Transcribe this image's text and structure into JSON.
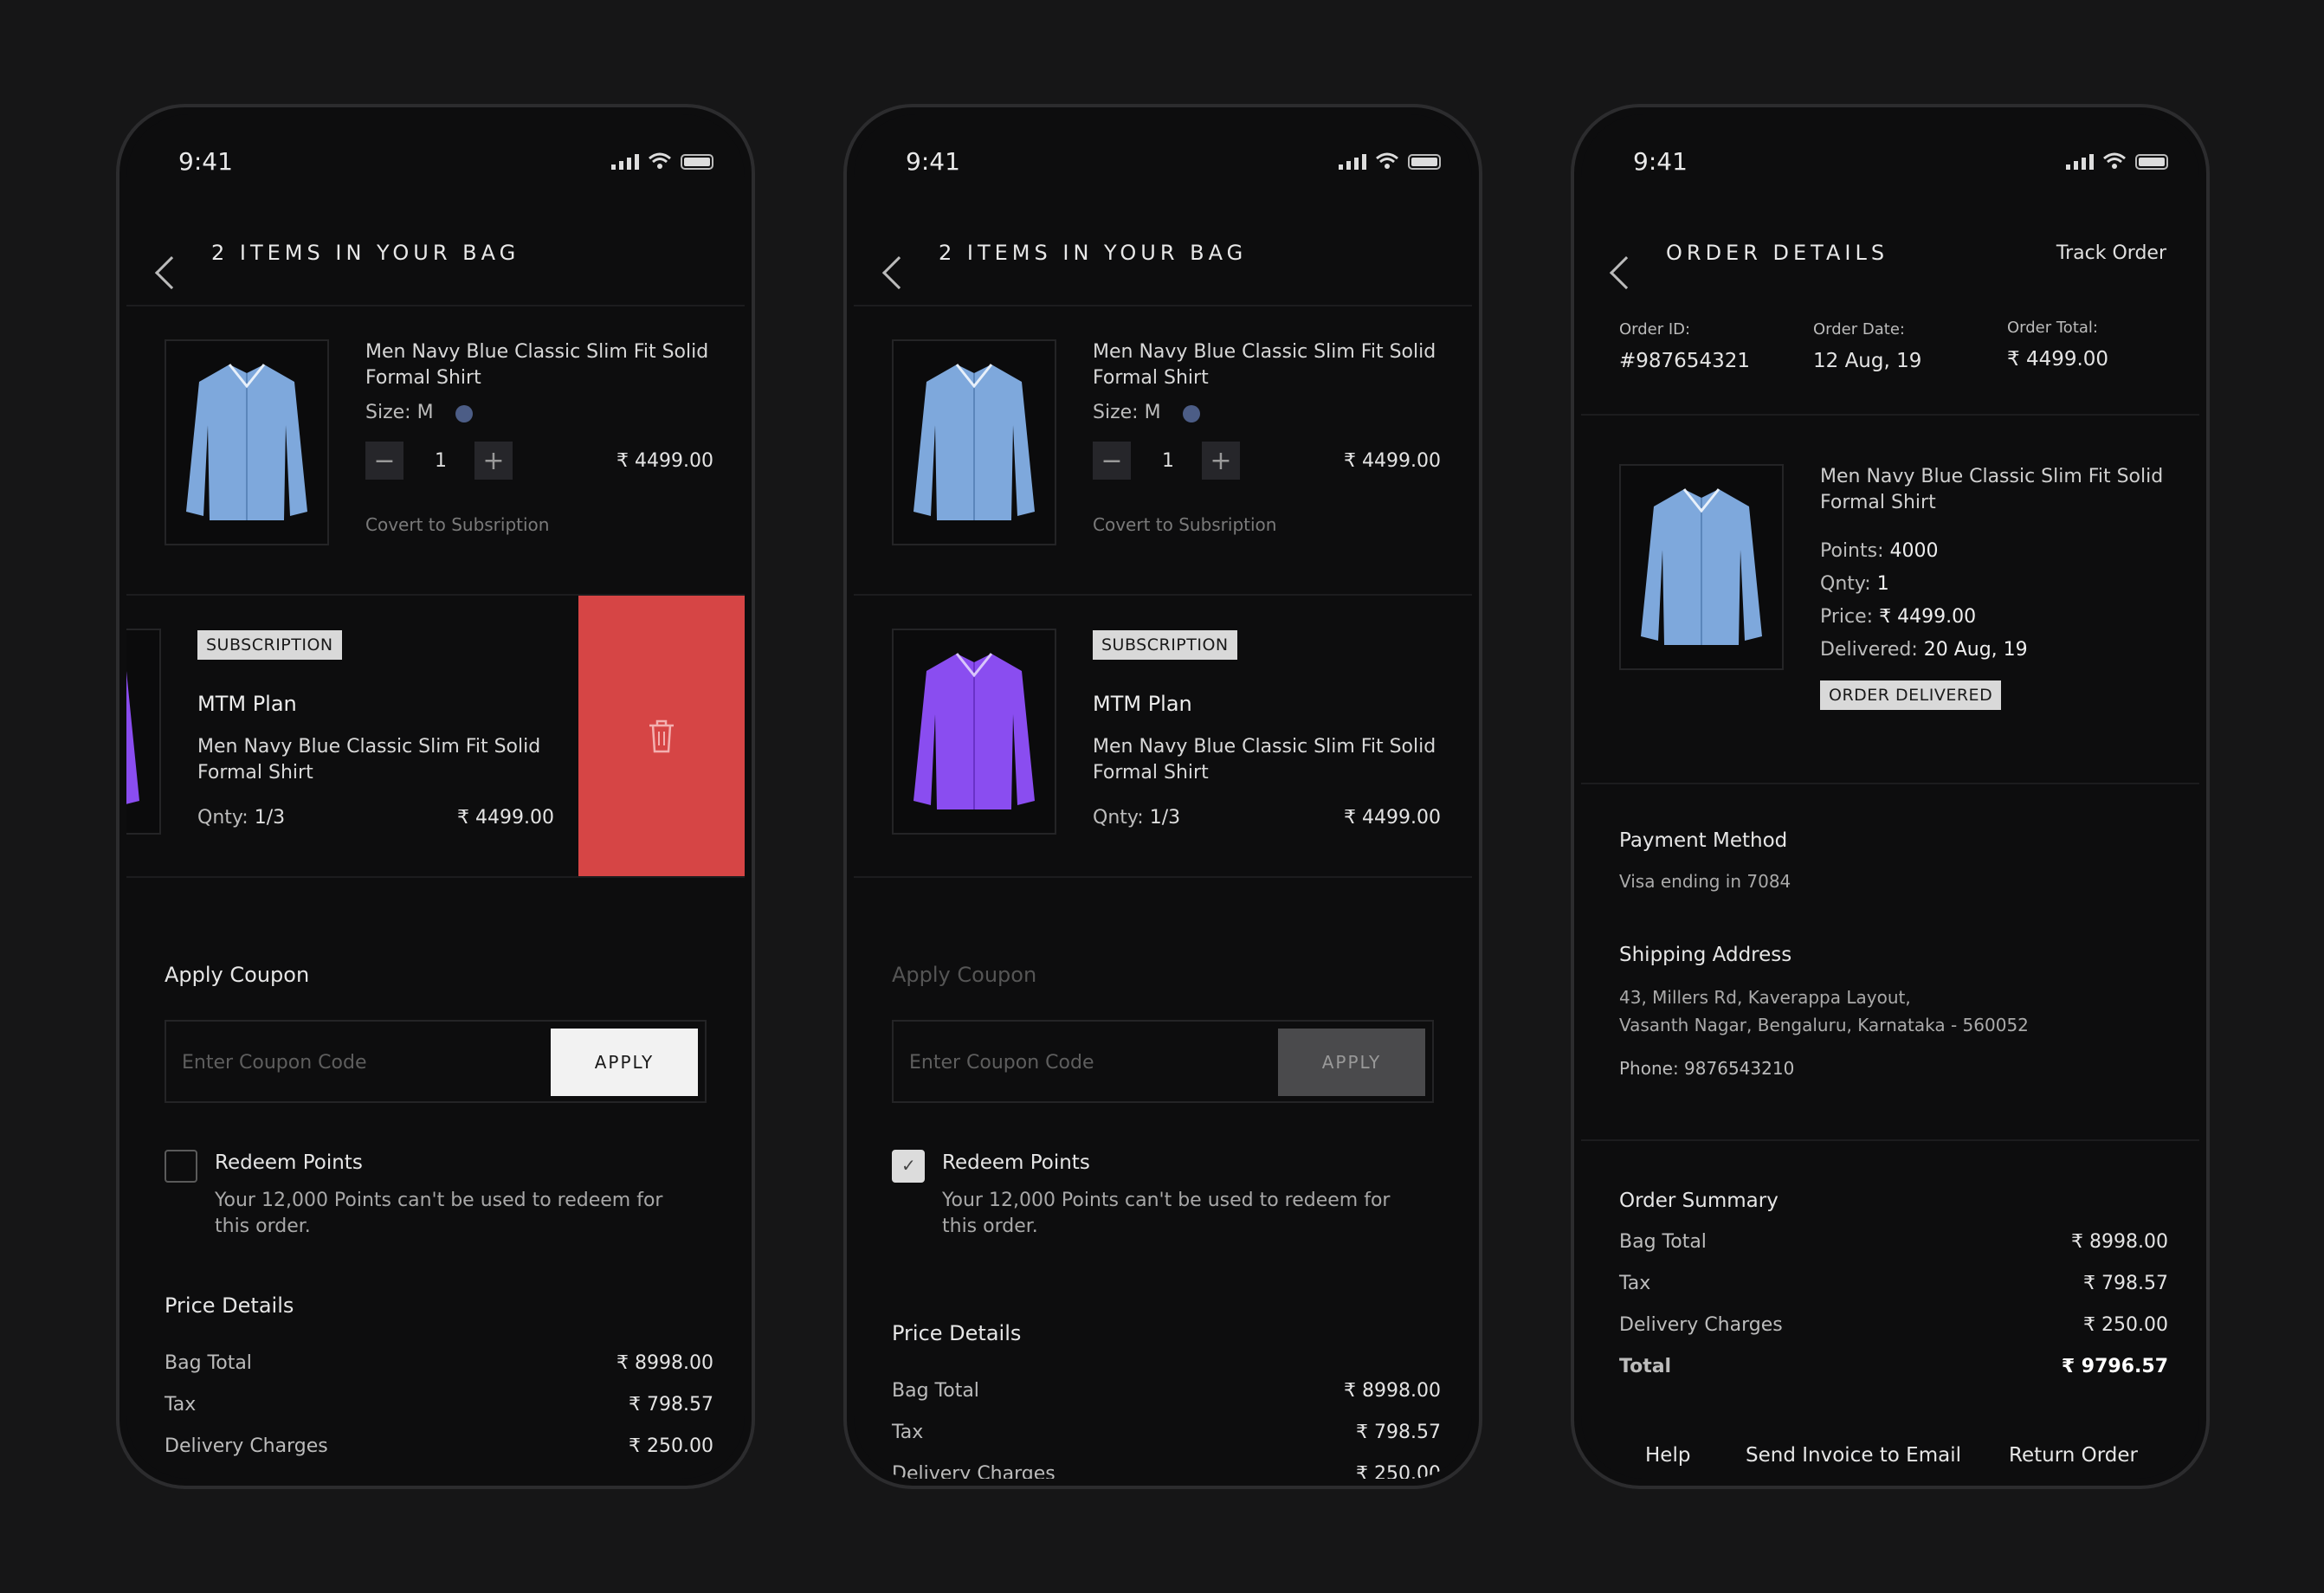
{
  "status": {
    "time": "9:41"
  },
  "screens": {
    "cart": {
      "title": "2 ITEMS IN YOUR BAG",
      "item1": {
        "name": "Men Navy Blue Classic Slim Fit Solid Formal Shirt",
        "size_label": "Size: M",
        "qty": "1",
        "price": "₹ 4499.00",
        "convert": "Covert to Subsription"
      },
      "item2": {
        "tag": "SUBSCRIPTION",
        "plan": "MTM Plan",
        "name": "Men Navy Blue Classic Slim Fit Solid Formal Shirt",
        "qty_label": "Qnty:",
        "qty_value": "1/3",
        "price": "₹ 4499.00"
      },
      "coupon": {
        "title": "Apply Coupon",
        "placeholder": "Enter Coupon Code",
        "button": "APPLY"
      },
      "redeem": {
        "title": "Redeem Points",
        "desc": "Your 12,000 Points can't be used to redeem for this order."
      },
      "price_details": {
        "title": "Price Details",
        "rows": [
          {
            "label": "Bag Total",
            "value": "₹ 8998.00"
          },
          {
            "label": "Tax",
            "value": "₹ 798.57"
          },
          {
            "label": "Delivery Charges",
            "value": "₹ 250.00"
          }
        ]
      }
    },
    "order": {
      "title": "ORDER DETAILS",
      "track": "Track Order",
      "order_id_label": "Order ID:",
      "order_id": "#987654321",
      "order_date_label": "Order Date:",
      "order_date": "12 Aug, 19",
      "order_total_label": "Order Total:",
      "order_total": "₹ 4499.00",
      "item": {
        "name": "Men Navy Blue Classic Slim Fit Solid Formal Shirt",
        "points_label": "Points:",
        "points": "4000",
        "qty_label": "Qnty:",
        "qty": "1",
        "price_label": "Price:",
        "price": "₹ 4499.00",
        "delivered_label": "Delivered:",
        "delivered": "20 Aug, 19",
        "status": "ORDER DELIVERED"
      },
      "payment": {
        "title": "Payment Method",
        "value": "Visa ending in 7084"
      },
      "shipping": {
        "title": "Shipping Address",
        "line1": "43, Millers Rd, Kaverappa Layout,",
        "line2": "Vasanth Nagar, Bengaluru, Karnataka - 560052",
        "phone": "Phone: 9876543210"
      },
      "summary": {
        "title": "Order Summary",
        "rows": [
          {
            "label": "Bag Total",
            "value": "₹ 8998.00"
          },
          {
            "label": "Tax",
            "value": "₹ 798.57"
          },
          {
            "label": "Delivery Charges",
            "value": "₹ 250.00"
          }
        ],
        "total_label": "Total",
        "total_value": "₹ 9796.57"
      },
      "footer": {
        "help": "Help",
        "invoice": "Send Invoice to Email",
        "return": "Return Order"
      }
    }
  },
  "colors": {
    "background": "#161617",
    "delete_red": "#d64545",
    "shirt_blue": "#7ea8dc",
    "shirt_purple": "#8a4df0",
    "size_dot": "#4c5d86"
  },
  "icons": [
    "back-chevron-icon",
    "signal-icon",
    "wifi-icon",
    "battery-icon",
    "trash-icon",
    "minus-icon",
    "plus-icon",
    "check-icon",
    "shirt-icon"
  ]
}
